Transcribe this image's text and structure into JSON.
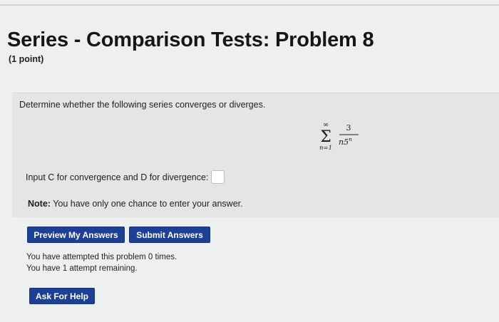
{
  "header": {
    "title": "Series - Comparison Tests: Problem 8",
    "points": "(1 point)"
  },
  "problem": {
    "prompt": "Determine whether the following series converges or diverges.",
    "series": {
      "upper": "∞",
      "lower": "n=1",
      "numerator": "3",
      "denominator_base": "n5",
      "denominator_exp": "n"
    },
    "answer_label": "Input C for convergence and D for divergence:",
    "answer_value": "",
    "note_label": "Note:",
    "note_text": " You have only one chance to enter your answer."
  },
  "actions": {
    "preview_label": "Preview My Answers",
    "submit_label": "Submit Answers",
    "help_label": "Ask For Help"
  },
  "attempts": {
    "line1": "You have attempted this problem 0 times.",
    "line2": "You have 1 attempt remaining."
  },
  "colors": {
    "button_bg": "#1c3f97",
    "page_bg": "#eef0ef",
    "problem_bg": "#e4e6e5"
  }
}
